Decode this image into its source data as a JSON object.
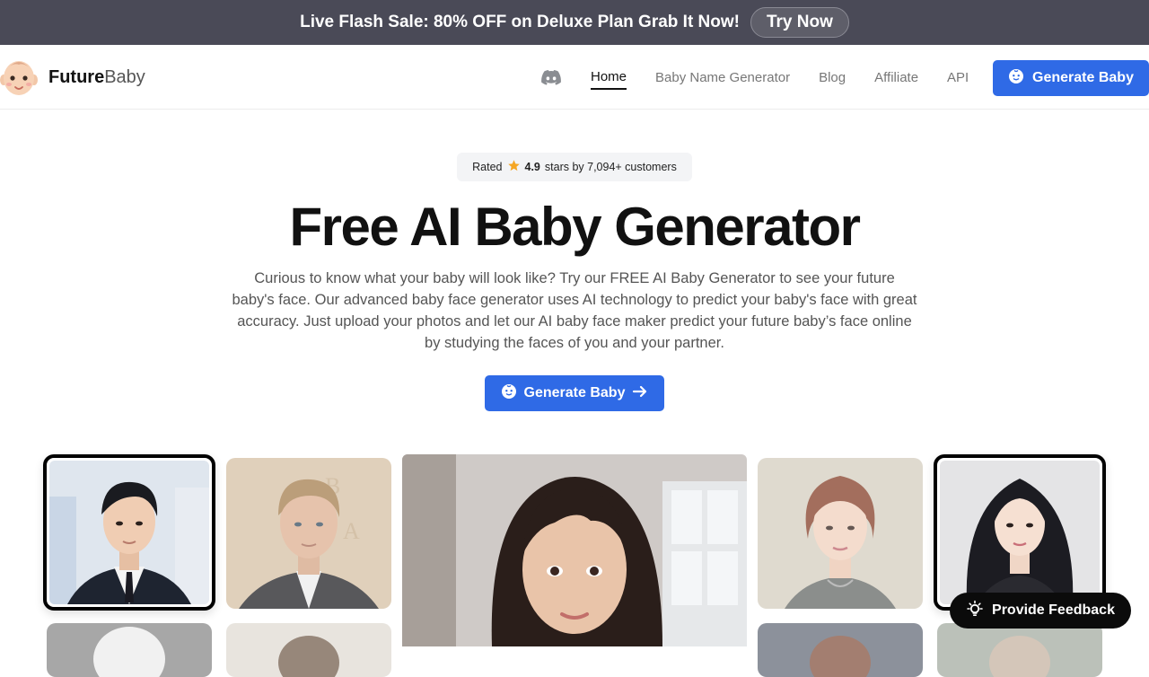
{
  "promo": {
    "text": "Live Flash Sale: 80% OFF on Deluxe Plan Grab It Now!",
    "button": "Try Now"
  },
  "brand": {
    "bold": "Future",
    "light": "Baby"
  },
  "nav": {
    "discord_icon": "discord-icon",
    "items": [
      "Home",
      "Baby Name Generator",
      "Blog",
      "Affiliate",
      "API"
    ],
    "active": "Home",
    "cta": "Generate Baby"
  },
  "hero": {
    "rating_prefix": "Rated",
    "rating_value": "4.9",
    "rating_suffix": "stars by 7,094+ customers",
    "title": "Free AI Baby Generator",
    "description": "Curious to know what your baby will look like? Try our FREE AI Baby Generator to see your future baby's face. Our advanced baby face generator uses AI technology to predict your baby's face with great accuracy. Just upload your photos and let our AI baby face maker predict your future baby’s face online by studying the faces of you and your partner.",
    "cta": "Generate Baby"
  },
  "feedback": {
    "label": "Provide Feedback",
    "icon": "lightbulb-icon"
  },
  "colors": {
    "promo_bg": "#4a4a57",
    "accent": "#2f6ae6",
    "title": "#111111"
  }
}
